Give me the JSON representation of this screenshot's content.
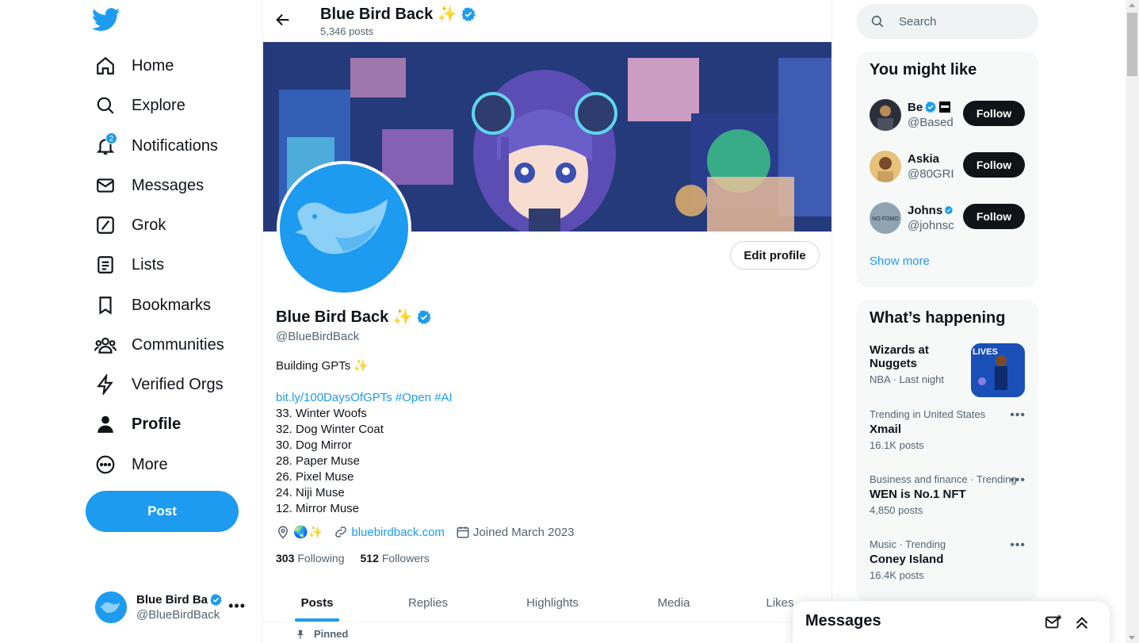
{
  "nav": {
    "items": [
      {
        "label": "Home",
        "icon": "home-icon"
      },
      {
        "label": "Explore",
        "icon": "search-icon"
      },
      {
        "label": "Notifications",
        "icon": "bell-icon",
        "badge": "2"
      },
      {
        "label": "Messages",
        "icon": "mail-icon"
      },
      {
        "label": "Grok",
        "icon": "grok-icon"
      },
      {
        "label": "Lists",
        "icon": "list-icon"
      },
      {
        "label": "Bookmarks",
        "icon": "bookmark-icon"
      },
      {
        "label": "Communities",
        "icon": "people-icon"
      },
      {
        "label": "Verified Orgs",
        "icon": "lightning-icon"
      },
      {
        "label": "Profile",
        "icon": "person-icon",
        "active": true
      },
      {
        "label": "More",
        "icon": "more-circle-icon"
      }
    ],
    "post_label": "Post",
    "account": {
      "name": "Blue Bird Ba",
      "handle": "@BlueBirdBack"
    }
  },
  "header": {
    "title": "Blue Bird Back ✨",
    "posts_count": "5,346 posts"
  },
  "profile": {
    "name": "Blue Bird Back ✨",
    "handle": "@BlueBirdBack",
    "edit_label": "Edit profile",
    "bio_line1": "Building GPTs ✨",
    "bio_link": "bit.ly/100DaysOfGPTs",
    "bio_tag1": "#Open",
    "bio_tag2": "#AI",
    "bio_list": [
      "33. Winter Woofs",
      "32. Dog Winter Coat",
      "30. Dog Mirror",
      "28. Paper Muse",
      "26. Pixel Muse",
      "24. Niji Muse",
      "12. Mirror Muse"
    ],
    "location": "🌏✨",
    "website": "bluebirdback.com",
    "joined": "Joined March 2023",
    "following_count": "303",
    "following_label": "Following",
    "followers_count": "512",
    "followers_label": "Followers"
  },
  "tabs": [
    "Posts",
    "Replies",
    "Highlights",
    "Media",
    "Likes"
  ],
  "pinned_label": "Pinned",
  "search": {
    "placeholder": "Search"
  },
  "suggestions": {
    "title": "You might like",
    "items": [
      {
        "name": "Be",
        "handle": "@Based",
        "follow": "Follow"
      },
      {
        "name": "Askia",
        "handle": "@80GRI",
        "follow": "Follow"
      },
      {
        "name": "Johns",
        "handle": "@johnsc",
        "follow": "Follow"
      }
    ],
    "show_more": "Show more"
  },
  "happening": {
    "title": "What’s happening",
    "items": [
      {
        "context": "",
        "title": "Wizards at Nuggets",
        "sub": "NBA · Last night"
      },
      {
        "context": "Trending in United States",
        "title": "Xmail",
        "sub": "16.1K posts"
      },
      {
        "context": "Business and finance · Trending",
        "title": "WEN is No.1 NFT",
        "sub": "4,850 posts"
      },
      {
        "context": "Music · Trending",
        "title": "Coney Island",
        "sub": "16.4K posts"
      }
    ]
  },
  "messages_drawer": {
    "title": "Messages"
  },
  "colors": {
    "accent": "#1d9bf0",
    "text": "#0f1419",
    "muted": "#536471"
  }
}
